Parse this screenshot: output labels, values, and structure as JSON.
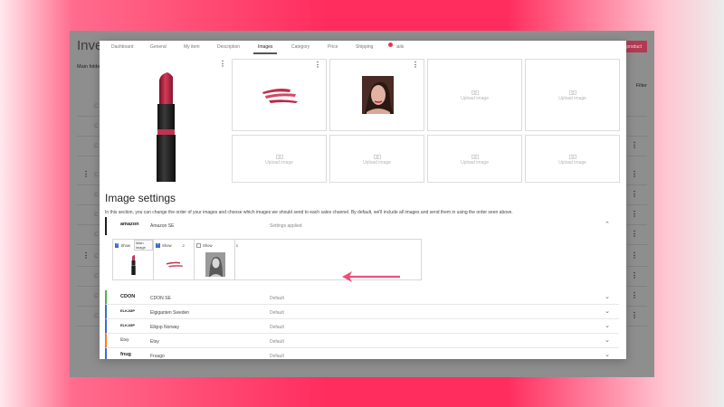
{
  "background_app": {
    "title": "Inventory",
    "folder_label": "Main folder",
    "filter_label": "Filter",
    "new_product_label": "product",
    "row_text": "C"
  },
  "tabs": [
    {
      "label": "Dashboard",
      "active": false
    },
    {
      "label": "General",
      "active": false
    },
    {
      "label": "My item",
      "active": false
    },
    {
      "label": "Description",
      "active": false
    },
    {
      "label": "Images",
      "active": true
    },
    {
      "label": "Category",
      "active": false
    },
    {
      "label": "Price",
      "active": false
    },
    {
      "label": "Shipping",
      "active": false
    },
    {
      "label": "Details",
      "active": false
    }
  ],
  "upload_label": "Upload image",
  "image_settings": {
    "title": "Image settings",
    "description": "In this section, you can change the order of your images and choose which images we should send to each sales channel. By default, we'll include all images and send them in using the order seen above."
  },
  "expanded_channel": {
    "logo": "amazon",
    "name": "Amazon SE",
    "status": "Settings applied",
    "image_options": [
      {
        "show_label": "Show",
        "checked": true,
        "main_label": "Main image",
        "badge": ""
      },
      {
        "show_label": "Show",
        "checked": true,
        "main_label": "",
        "badge": "2"
      },
      {
        "show_label": "Show",
        "checked": false,
        "main_label": "",
        "badge": "3"
      }
    ]
  },
  "channels": [
    {
      "logo": "CDON",
      "name": "CDON SE",
      "status": "Default",
      "color": "#4caf50"
    },
    {
      "logo": "ELKJØP",
      "name": "Elgiganten Sweden",
      "status": "Default",
      "color": "#3a6fd0"
    },
    {
      "logo": "ELKJØP",
      "name": "Elkjop Norway",
      "status": "Default",
      "color": "#3a6fd0"
    },
    {
      "logo": "Etsy",
      "name": "Etsy",
      "status": "Default",
      "color": "#f07f2b"
    },
    {
      "logo": "fnug",
      "name": "Fruugo",
      "status": "Default",
      "color": "#3a6fd0"
    }
  ],
  "colors": {
    "accent": "#e8496a",
    "modal_bg": "#ffffff",
    "overlay": "#8e8e8e"
  }
}
